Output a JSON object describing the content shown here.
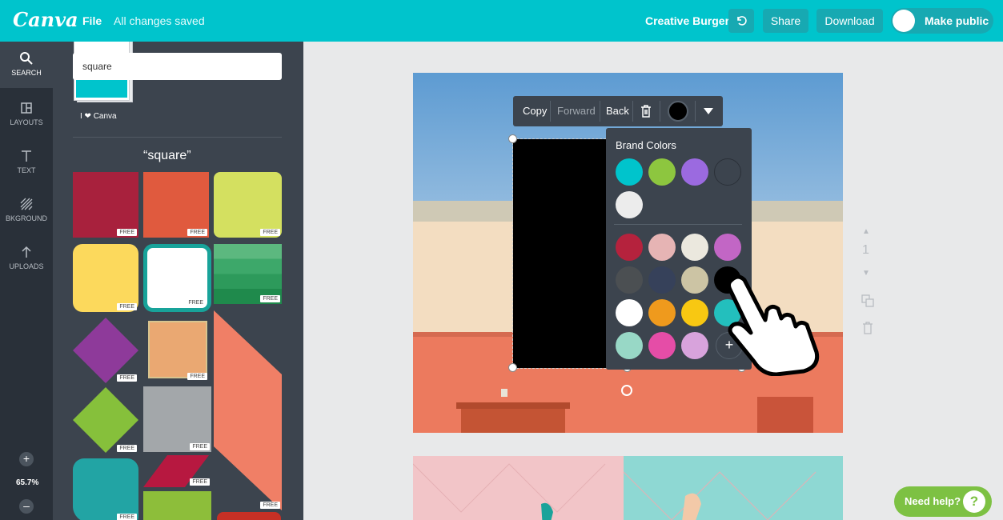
{
  "topbar": {
    "logo": "Canva",
    "file": "File",
    "saved": "All changes saved",
    "title": "Creative Burger",
    "undo_icon": "undo-icon",
    "share": "Share",
    "download": "Download",
    "make_public": "Make public",
    "accent": "#00c4cc"
  },
  "rail": {
    "items": [
      {
        "label": "SEARCH",
        "icon": "search-icon"
      },
      {
        "label": "LAYOUTS",
        "icon": "layouts-icon"
      },
      {
        "label": "TEXT",
        "icon": "text-icon"
      },
      {
        "label": "BKGROUND",
        "icon": "background-icon"
      },
      {
        "label": "UPLOADS",
        "icon": "upload-icon"
      }
    ],
    "zoom_in": "+",
    "zoom": "65.7%",
    "zoom_out": "–"
  },
  "panel": {
    "search_value": "square",
    "canva_label": "I ❤ Canva",
    "section_title": "“square”",
    "free": "FREE"
  },
  "context_menu": {
    "copy": "Copy",
    "forward": "Forward",
    "back": "Back",
    "delete_icon": "trash-icon",
    "color_swatch": "#000000",
    "more_icon": "caret-down-icon"
  },
  "palette": {
    "heading": "Brand Colors",
    "brand": [
      "#00c4cc",
      "#8dc63f",
      "#9b6ae0",
      "#3c444e",
      "#ececec"
    ],
    "colors": [
      "#b5223d",
      "#e6b4b4",
      "#ebe8de",
      "#c266c5",
      "#4b4f52",
      "#36415a",
      "#ccc4a4",
      "#000000",
      "#ffffff",
      "#ef9a1d",
      "#f8c812",
      "#23bfbd",
      "#98d8c6",
      "#e54da7",
      "#d8a3dc"
    ],
    "add": "+"
  },
  "page_controls": {
    "page_number": "1"
  },
  "help": {
    "label": "Need help?",
    "icon": "?"
  }
}
